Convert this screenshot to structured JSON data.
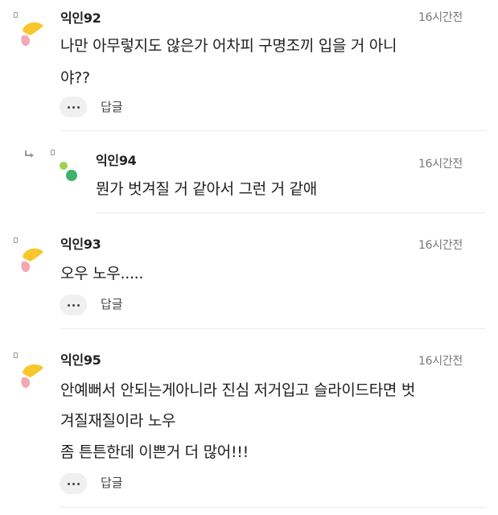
{
  "comments": [
    {
      "author": "익인92",
      "time": "16시간전",
      "lines": [
        "나만 아무렇지도 않은가 어차피 구명조끼 입을 거 아니",
        "야??"
      ],
      "more_label": "more-options",
      "reply_label": "답글",
      "avatar_icon": "yellow-pink-blob-icon"
    },
    {
      "author": "익인94",
      "time": "16시간전",
      "lines": [
        "뭔가 벗겨질 거 같아서 그런 거 같애"
      ],
      "is_reply": true,
      "avatar_icon": "green-dots-icon"
    },
    {
      "author": "익인93",
      "time": "16시간전",
      "lines": [
        "오우 노우....."
      ],
      "reply_label": "답글",
      "avatar_icon": "yellow-pink-blob-icon"
    },
    {
      "author": "익인95",
      "time": "16시간전",
      "lines": [
        "안예뻐서 안되는게아니라 진심 저거입고 슬라이드타면 벗",
        "겨질재질이라 노우",
        "좀 튼튼한데 이쁜거 더 많어!!!"
      ],
      "reply_label": "답글",
      "avatar_icon": "yellow-pink-blob-icon"
    }
  ],
  "colors": {
    "avatar_yellow": "#f7c72b",
    "avatar_pink": "#f2a9b4",
    "avatar_green_dark": "#3fb36b",
    "avatar_green_light": "#9cd34a"
  }
}
